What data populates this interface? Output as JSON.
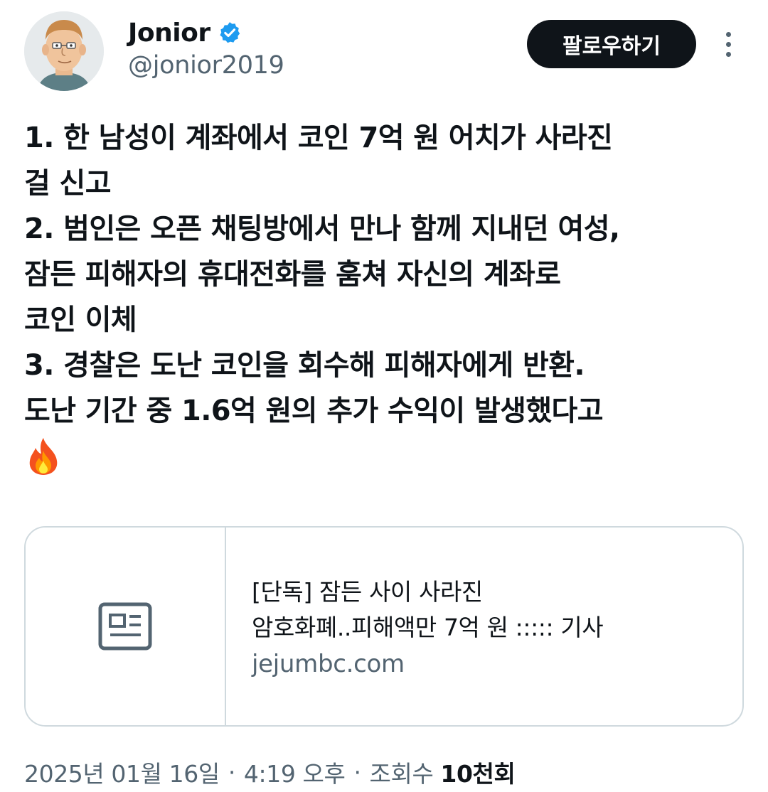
{
  "author": {
    "display_name": "Jonior",
    "handle": "@jonior2019",
    "verified": true,
    "avatar_icon": "cartoon-man-avatar"
  },
  "actions": {
    "follow_label": "팔로우하기",
    "more_icon": "more-vertical-icon"
  },
  "tweet": {
    "lines": [
      "1. 한 남성이 계좌에서 코인 7억 원 어치가 사라진",
      "걸 신고",
      "2. 범인은 오픈 채팅방에서 만나 함께 지내던 여성,",
      "잠든 피해자의 휴대전화를 훔쳐 자신의 계좌로",
      "코인 이체",
      "3. 경찰은 도난 코인을 회수해 피해자에게 반환.",
      "도난 기간 중 1.6억 원의 추가 수익이 발생했다고"
    ],
    "emoji": "fire-emoji"
  },
  "link_card": {
    "thumb_icon": "article-icon",
    "title_line1": "[단독] 잠든 사이 사라진",
    "title_line2": "암호화폐..피해액만 7억 원 ::::: 기사",
    "domain": "jejumbc.com"
  },
  "meta": {
    "date": "2025년 01월 16일",
    "separator": "·",
    "time": "4:19 오후",
    "views_label": "조회수",
    "views_count": "10천회"
  },
  "colors": {
    "text_primary": "#0f1419",
    "text_secondary": "#536471",
    "verified_blue": "#1d9bf0",
    "border": "#cfd9de",
    "button_bg": "#0f1419"
  }
}
